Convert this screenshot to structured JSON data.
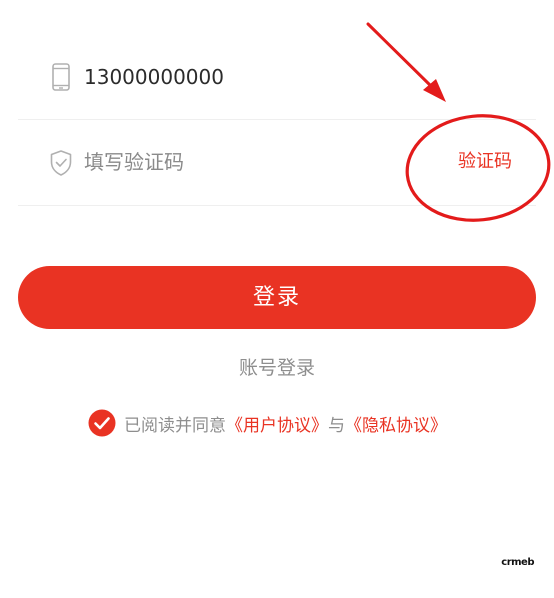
{
  "form": {
    "phone": {
      "icon": "mobile-phone-icon",
      "value": "13000000000"
    },
    "code": {
      "icon": "shield-check-icon",
      "placeholder": "填写验证码",
      "get_code_label": "验证码"
    }
  },
  "login_button_label": "登录",
  "account_login_label": "账号登录",
  "agreement": {
    "checkbox_icon": "checkmark-circle-icon",
    "checked": true,
    "prefix": "已阅读并同意",
    "user_agreement": "《用户协议》",
    "conjunction": "与",
    "privacy_policy": "《隐私协议》"
  },
  "watermark": {
    "text": "crmeb"
  },
  "colors": {
    "accent": "#e93323",
    "text_primary": "#2b2b2b",
    "text_secondary": "#8e8e8e",
    "divider": "#efefef",
    "annotation": "#e31b1b"
  }
}
